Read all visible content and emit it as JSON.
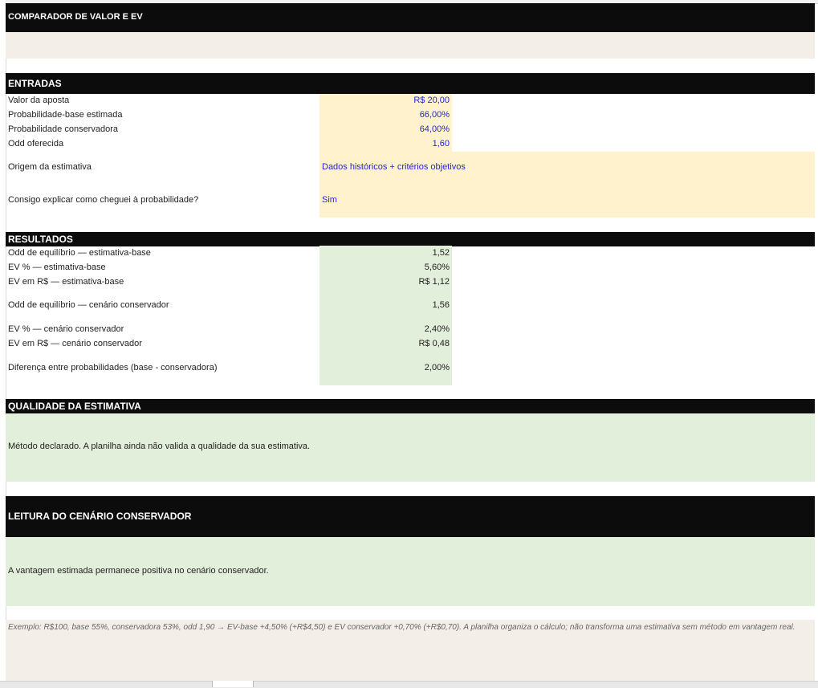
{
  "title": "COMPARADOR DE VALOR E EV",
  "entradas": {
    "header": "ENTRADAS",
    "rows": [
      {
        "label": "Valor da aposta",
        "value": "R$ 20,00"
      },
      {
        "label": "Probabilidade-base estimada",
        "value": "66,00%"
      },
      {
        "label": "Probabilidade conservadora",
        "value": "64,00%"
      },
      {
        "label": "Odd oferecida",
        "value": "1,60"
      }
    ],
    "origem_label": "Origem da estimativa",
    "origem_value": "Dados históricos + critérios objetivos",
    "explicar_label": "Consigo explicar como cheguei à probabilidade?",
    "explicar_value": "Sim"
  },
  "resultados": {
    "header": "RESULTADOS",
    "rows": [
      {
        "label": "Odd de equilíbrio — estimativa-base",
        "value": "1,52"
      },
      {
        "label": "EV % — estimativa-base",
        "value": "5,60%"
      },
      {
        "label": "EV em R$ — estimativa-base",
        "value": "R$ 1,12"
      },
      {
        "label": "Odd de equilíbrio — cenário conservador",
        "value": "1,56"
      },
      {
        "label": "EV % — cenário conservador",
        "value": "2,40%"
      },
      {
        "label": "EV em R$ — cenário conservador",
        "value": "R$ 0,48"
      },
      {
        "label": "Diferença entre probabilidades (base - conservadora)",
        "value": "2,00%"
      }
    ]
  },
  "qualidade": {
    "header": "QUALIDADE DA ESTIMATIVA",
    "text": "Método declarado. A planilha ainda não valida a qualidade da sua estimativa."
  },
  "leitura": {
    "header": "LEITURA DO CENÁRIO CONSERVADOR",
    "text": "A vantagem estimada permanece positiva no cenário conservador."
  },
  "exemplo": {
    "text": "Exemplo: R$100, base 55%, conservadora 53%, odd 1,90 → EV-base +4,50% (+R$4,50) e EV conservador +0,70% (+R$0,70). A planilha organiza o cálculo; não transforma uma estimativa sem método em vantagem real."
  },
  "colors": {
    "header_bg": "#0c0c0d",
    "input_bg": "#fff2cc",
    "input_text": "#2424d6",
    "result_bg": "#e2efda",
    "note_bg": "#f3efe8"
  }
}
